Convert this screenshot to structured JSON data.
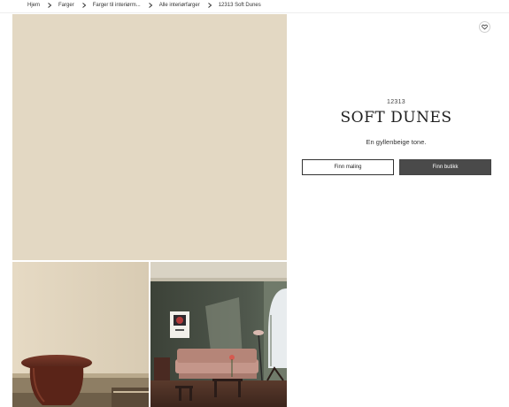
{
  "breadcrumb": {
    "items": [
      "Hjem",
      "Farger",
      "Farger til interiørm...",
      "Alle interiørfarger",
      "12313 Soft Dunes"
    ]
  },
  "colors": {
    "swatch": "#e3d8c3",
    "solid_button": "#4a4a4a"
  },
  "product": {
    "code": "12313",
    "name": "SOFT DUNES",
    "description": "En gyllenbeige tone.",
    "favorite_icon": "heart-icon"
  },
  "actions": {
    "find_paint_label": "Finn maling",
    "find_store_label": "Finn butikk"
  }
}
